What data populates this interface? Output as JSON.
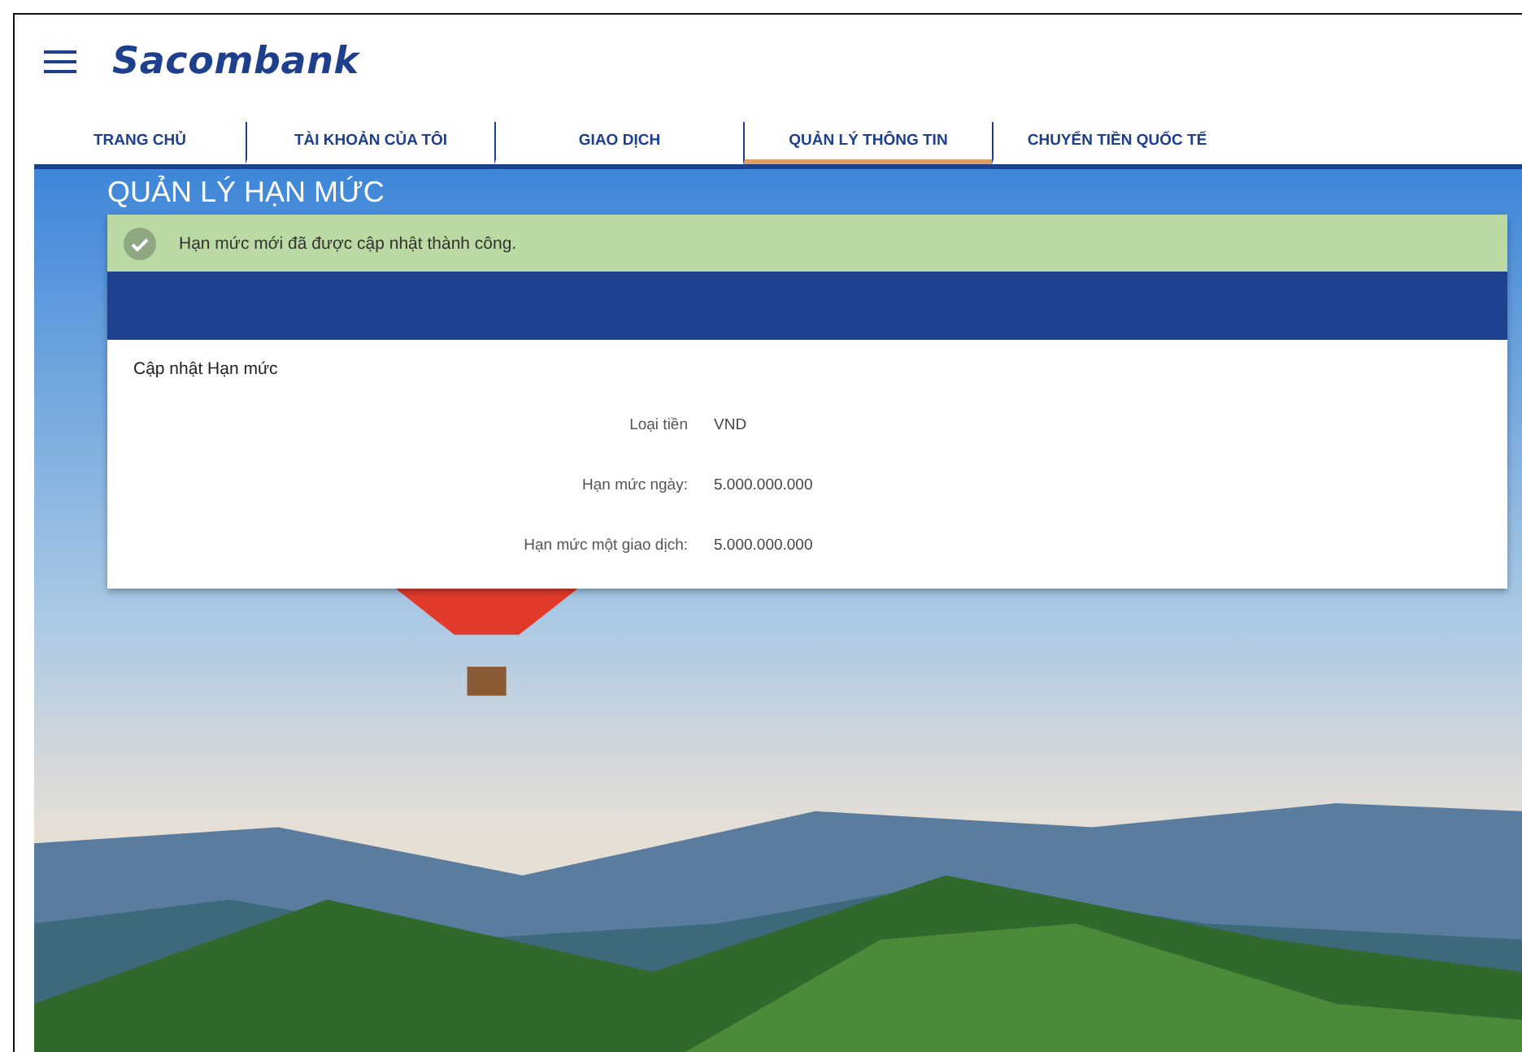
{
  "header": {
    "logo": "Sacombank"
  },
  "nav": [
    {
      "label": "TRANG CHỦ",
      "selected": false
    },
    {
      "label": "TÀI KHOẢN CỦA TÔI",
      "selected": false
    },
    {
      "label": "GIAO DỊCH",
      "selected": false
    },
    {
      "label": "QUẢN LÝ THÔNG TIN",
      "selected": true
    },
    {
      "label": "CHUYỂN TIỀN QUỐC TẾ",
      "selected": false
    }
  ],
  "page_title": "QUẢN LÝ HẠN MỨC",
  "alert": {
    "message": "Hạn mức mới đã được cập nhật thành công."
  },
  "form": {
    "title": "Cập nhật Hạn mức",
    "rows": [
      {
        "label": "Loại tiền",
        "value": "VND"
      },
      {
        "label": "Hạn mức ngày:",
        "value": "5.000.000.000"
      },
      {
        "label": "Hạn mức một giao dịch:",
        "value": "5.000.000.000"
      }
    ]
  }
}
